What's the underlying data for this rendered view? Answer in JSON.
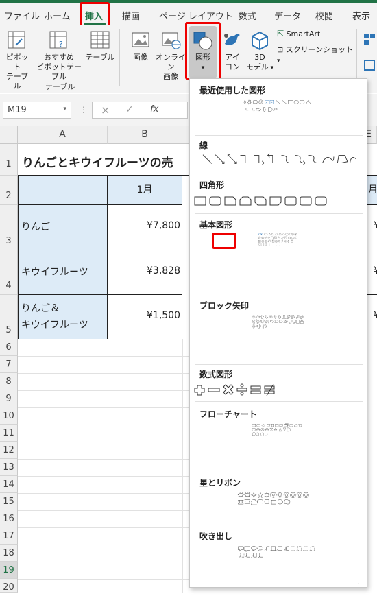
{
  "tabs": [
    "ファイル",
    "ホーム",
    "挿入",
    "描画",
    "ページ レイアウト",
    "数式",
    "データ",
    "校閲",
    "表示"
  ],
  "active_tab": "挿入",
  "ribbon": {
    "pivot_label_1": "ピボット",
    "pivot_label_2": "テーブル",
    "rec_pivot_label_1": "おすすめ",
    "rec_pivot_label_2": "ピボットテーブル",
    "table_label": "テーブル",
    "group_table": "テーブル",
    "picture_label": "画像",
    "online_label_1": "オンライン",
    "online_label_2": "画像",
    "shapes_label": "図形",
    "icons_label_1": "アイ",
    "icons_label_2": "コン",
    "model3d_label_1": "3D",
    "model3d_label_2": "モデル",
    "smartart_label": "SmartArt",
    "screenshot_label": "スクリーンショット"
  },
  "formula_bar": {
    "name_box": "M19",
    "cancel_icon": "×",
    "enter_icon": "✓",
    "fx": "fx"
  },
  "columns": [
    "A",
    "B",
    "E"
  ],
  "sheet": {
    "title": "りんごとキウイフルーツの売",
    "header_month": "1月",
    "header_month_partial": "月",
    "rows": [
      {
        "label": "りんご",
        "value": "¥7,800",
        "partial": "¥"
      },
      {
        "label": "キウイフルーツ",
        "value": "¥3,828",
        "partial": "¥"
      },
      {
        "label_1": "りんご＆",
        "label_2": "キウイフルーツ",
        "value": "¥1,500",
        "partial": "¥"
      }
    ],
    "row_numbers": [
      "1",
      "2",
      "3",
      "4",
      "5",
      "6",
      "7",
      "8",
      "9",
      "10",
      "11",
      "12",
      "13",
      "14",
      "15",
      "16",
      "17",
      "18",
      "19",
      "20"
    ]
  },
  "shapes_panel": {
    "sections": [
      "最近使用した図形",
      "線",
      "四角形",
      "基本図形",
      "ブロック矢印",
      "数式図形",
      "フローチャート",
      "星とリボン",
      "吹き出し"
    ]
  },
  "colors": {
    "accent_green": "#217346",
    "highlight_red": "#e00000",
    "cell_fill": "#ddebf7",
    "shape_blue": "#2e75b6"
  }
}
